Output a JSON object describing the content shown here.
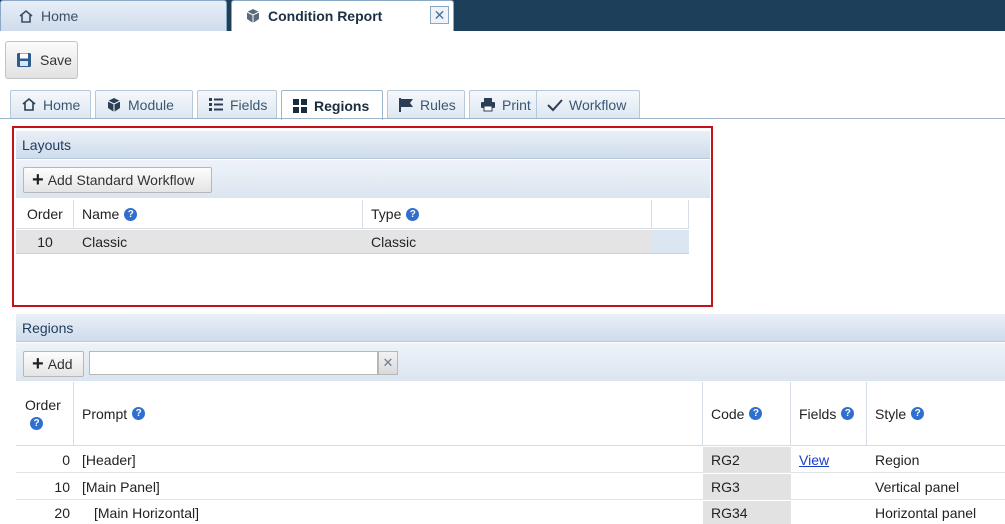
{
  "window_tabs": {
    "home": "Home",
    "current": "Condition Report"
  },
  "toolbar": {
    "save_label": "Save"
  },
  "tabs": [
    {
      "label": "Home",
      "icon": "home-icon"
    },
    {
      "label": "Module",
      "icon": "cube-icon"
    },
    {
      "label": "Fields",
      "icon": "list-icon"
    },
    {
      "label": "Regions",
      "icon": "grid-icon"
    },
    {
      "label": "Rules",
      "icon": "flag-icon"
    },
    {
      "label": "Print",
      "icon": "printer-icon"
    },
    {
      "label": "Workflow",
      "icon": "check-icon"
    }
  ],
  "active_tab": "Regions",
  "layouts": {
    "title": "Layouts",
    "add_button": "Add Standard Workflow",
    "columns": [
      "Order",
      "Name",
      "Type"
    ],
    "rows": [
      {
        "order": "10",
        "name": "Classic",
        "type": "Classic"
      }
    ]
  },
  "regions": {
    "title": "Regions",
    "add_button": "Add",
    "search_value": "",
    "clear_glyph": "✕",
    "columns": [
      "Order",
      "Prompt",
      "Code",
      "Fields",
      "Style"
    ],
    "rows": [
      {
        "order": "0",
        "prompt": "[Header]",
        "code": "RG2",
        "fields": "View",
        "style": "Region"
      },
      {
        "order": "10",
        "prompt": "[Main Panel]",
        "code": "RG3",
        "fields": "",
        "style": "Vertical panel"
      },
      {
        "order": "20",
        "prompt": "[Main Horizontal]",
        "code": "RG34",
        "fields": "",
        "style": "Horizontal panel"
      }
    ]
  },
  "colors": {
    "topbar": "#1e3f5a",
    "highlight_border": "#c4121c",
    "link": "#1a3ec9",
    "help_icon": "#2f6fcf"
  }
}
